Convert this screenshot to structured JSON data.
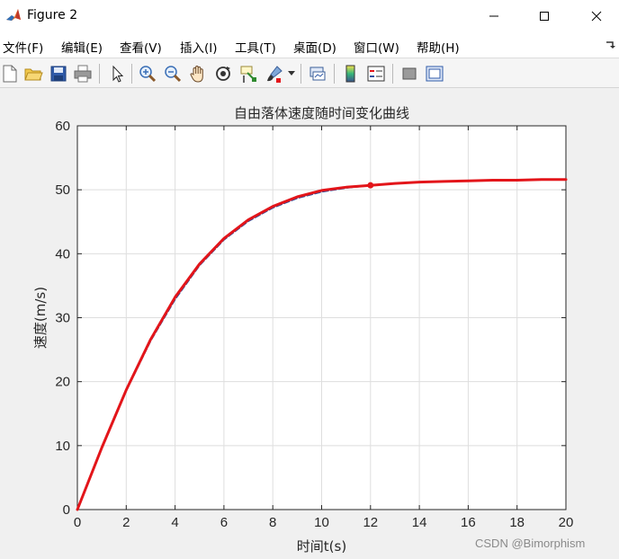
{
  "window": {
    "title": "Figure 2"
  },
  "menu": [
    "文件(F)",
    "编辑(E)",
    "查看(V)",
    "插入(I)",
    "工具(T)",
    "桌面(D)",
    "窗口(W)",
    "帮助(H)"
  ],
  "toolbar": {
    "buttons": [
      "new-figure-icon",
      "open-file-icon",
      "save-icon",
      "print-icon",
      "pointer-icon",
      "zoom-in-icon",
      "zoom-out-icon",
      "pan-hand-icon",
      "rotate-3d-icon",
      "data-cursor-icon",
      "brush-icon",
      "link-plot-icon",
      "colorbar-icon",
      "legend-icon",
      "hide-plot-tools-icon",
      "show-plot-tools-icon"
    ]
  },
  "chart_data": {
    "type": "line",
    "title": "自由落体速度随时间变化曲线",
    "xlabel": "时间t(s)",
    "ylabel": "速度(m/s)",
    "xlim": [
      0,
      20
    ],
    "ylim": [
      0,
      60
    ],
    "xticks": [
      0,
      2,
      4,
      6,
      8,
      10,
      12,
      14,
      16,
      18,
      20
    ],
    "yticks": [
      0,
      10,
      20,
      30,
      40,
      50,
      60
    ],
    "grid": true,
    "series": [
      {
        "color": "#2c4f9e",
        "style": "dashed",
        "x": [
          0,
          1,
          2,
          3,
          4,
          5,
          6,
          7,
          8,
          9,
          10,
          11,
          12,
          13,
          14,
          15,
          16,
          17,
          18,
          19,
          20
        ],
        "y": [
          0,
          9.6,
          18.6,
          26.4,
          32.9,
          38.2,
          42.2,
          45.1,
          47.2,
          48.7,
          49.7,
          50.3,
          50.7,
          51.0,
          51.2,
          51.3,
          51.4,
          51.5,
          51.5,
          51.6,
          51.6
        ]
      },
      {
        "color": "#e3151a",
        "style": "solid",
        "x": [
          0,
          1,
          2,
          3,
          4,
          5,
          6,
          7,
          8,
          9,
          10,
          11,
          12,
          13,
          14,
          15,
          16,
          17,
          18,
          19,
          20
        ],
        "y": [
          0,
          9.7,
          18.7,
          26.6,
          33.2,
          38.4,
          42.4,
          45.3,
          47.4,
          48.9,
          49.9,
          50.4,
          50.7,
          51.0,
          51.2,
          51.3,
          51.4,
          51.5,
          51.5,
          51.6,
          51.6
        ]
      }
    ],
    "markers": [
      {
        "x": 12,
        "y": 50.7,
        "color": "#e3151a"
      }
    ]
  },
  "watermark": "CSDN @Bimorphism"
}
